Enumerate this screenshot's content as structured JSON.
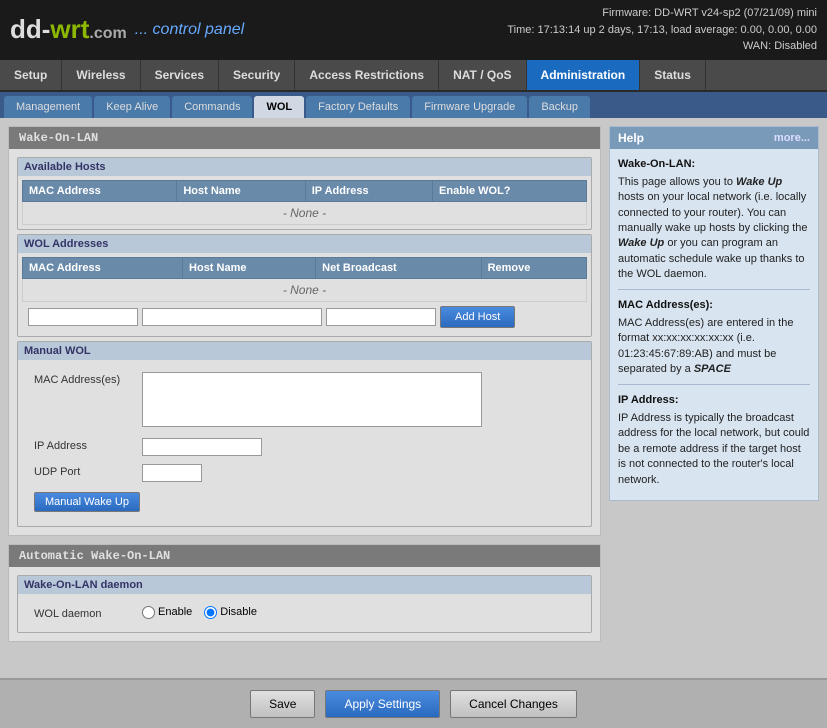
{
  "header": {
    "logo_dd": "dd-",
    "logo_wrt": "wrt",
    "logo_com": ".com",
    "logo_panel": "... control panel",
    "firmware": "Firmware: DD-WRT v24-sp2 (07/21/09) mini",
    "time": "Time: 17:13:14 up 2 days, 17:13, load average: 0.00, 0.00, 0.00",
    "wan": "WAN: Disabled"
  },
  "nav": {
    "tabs": [
      {
        "id": "setup",
        "label": "Setup"
      },
      {
        "id": "wireless",
        "label": "Wireless"
      },
      {
        "id": "services",
        "label": "Services"
      },
      {
        "id": "security",
        "label": "Security"
      },
      {
        "id": "access",
        "label": "Access Restrictions"
      },
      {
        "id": "nat",
        "label": "NAT / QoS"
      },
      {
        "id": "administration",
        "label": "Administration",
        "active": true
      },
      {
        "id": "status",
        "label": "Status"
      }
    ],
    "sub_tabs": [
      {
        "id": "management",
        "label": "Management"
      },
      {
        "id": "keepalive",
        "label": "Keep Alive"
      },
      {
        "id": "commands",
        "label": "Commands"
      },
      {
        "id": "wol",
        "label": "WOL",
        "active": true
      },
      {
        "id": "factory",
        "label": "Factory Defaults"
      },
      {
        "id": "firmware",
        "label": "Firmware Upgrade"
      },
      {
        "id": "backup",
        "label": "Backup"
      }
    ]
  },
  "wake_on_lan": {
    "title": "Wake-On-LAN",
    "available_hosts": {
      "title": "Available Hosts",
      "columns": [
        "MAC Address",
        "Host Name",
        "IP Address",
        "Enable WOL?"
      ],
      "none_text": "- None -"
    },
    "wol_addresses": {
      "title": "WOL Addresses",
      "columns": [
        "MAC Address",
        "Host Name",
        "Net Broadcast",
        "Remove"
      ],
      "none_text": "- None -",
      "add_button": "Add Host",
      "inputs": {
        "mac_placeholder": "",
        "host_placeholder": "",
        "ip_placeholder": ""
      }
    },
    "manual_wol": {
      "title": "Manual WOL",
      "mac_label": "MAC Address(es)",
      "ip_label": "IP Address",
      "port_label": "UDP Port",
      "wakeup_button": "Manual Wake Up"
    }
  },
  "automatic_wol": {
    "title": "Automatic Wake-On-LAN",
    "daemon": {
      "title": "Wake-On-LAN daemon",
      "label": "WOL daemon",
      "options": [
        "Enable",
        "Disable"
      ],
      "selected": "Disable"
    }
  },
  "help": {
    "title": "Help",
    "more_link": "more...",
    "wol_title": "Wake-On-LAN:",
    "wol_text1": "This page allows you to ",
    "wol_wake_italic": "Wake Up",
    "wol_text2": " hosts on your local network (i.e. locally connected to your router). You can manually wake up hosts by clicking the ",
    "wol_wake_italic2": "Wake Up",
    "wol_text3": " or you can program an automatic schedule wake up thanks to the WOL daemon.",
    "mac_title": "MAC Address(es):",
    "mac_text": "MAC Address(es) are entered in the format xx:xx:xx:xx:xx:xx (i.e. 01:23:45:67:89:AB) and must be separated by a ",
    "mac_space": "SPACE",
    "ip_title": "IP Address:",
    "ip_text": "IP Address is typically the broadcast address for the local network, but could be a remote address if the target host is not connected to the router's local network."
  },
  "buttons": {
    "save": "Save",
    "apply": "Apply Settings",
    "cancel": "Cancel Changes"
  }
}
